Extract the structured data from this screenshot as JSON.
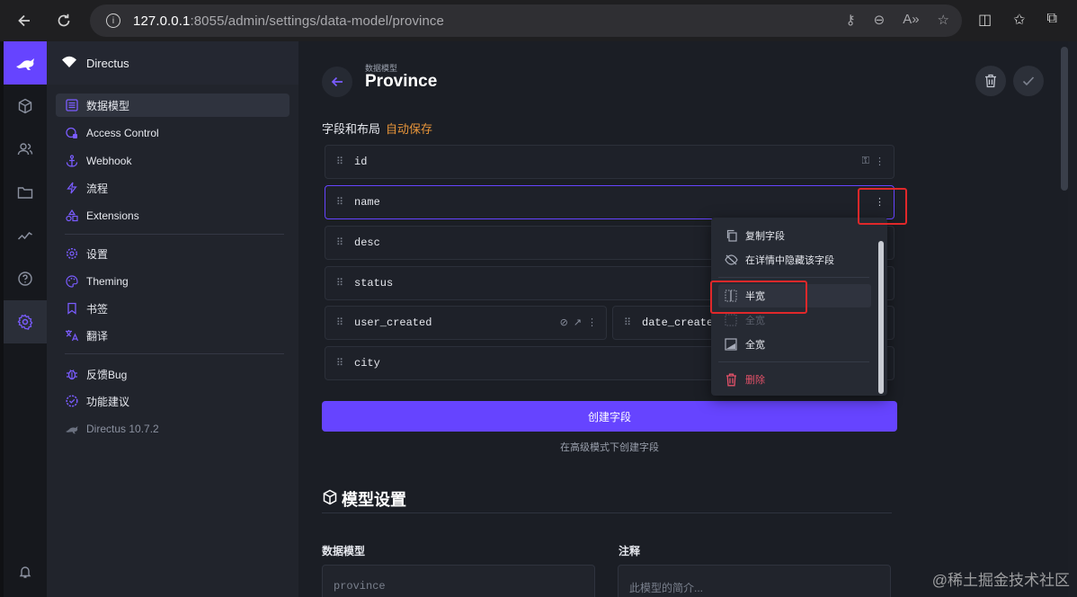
{
  "browser": {
    "url_host": "127.0.0.1",
    "url_rest": ":8055/admin/settings/data-model/province"
  },
  "project": {
    "name": "Directus"
  },
  "sidebar": {
    "items": [
      {
        "label": "数据模型",
        "icon": "data-model-icon"
      },
      {
        "label": "Access Control",
        "icon": "access-control-icon"
      },
      {
        "label": "Webhook",
        "icon": "anchor-icon"
      },
      {
        "label": "流程",
        "icon": "bolt-icon"
      },
      {
        "label": "Extensions",
        "icon": "extensions-icon"
      },
      {
        "label": "设置",
        "icon": "gear-icon"
      },
      {
        "label": "Theming",
        "icon": "palette-icon"
      },
      {
        "label": "书签",
        "icon": "bookmark-icon"
      },
      {
        "label": "翻译",
        "icon": "translate-icon"
      },
      {
        "label": "反馈Bug",
        "icon": "bug-icon"
      },
      {
        "label": "功能建议",
        "icon": "feature-icon"
      }
    ],
    "version": "Directus 10.7.2"
  },
  "header": {
    "breadcrumb": "数据模型",
    "title": "Province"
  },
  "fields_section": {
    "label": "字段和布局",
    "autosave": "自动保存"
  },
  "fields": {
    "id": "id",
    "name": "name",
    "desc": "desc",
    "status": "status",
    "user_created": "user_created",
    "date_created": "date_create",
    "city": "city"
  },
  "create_button": "创建字段",
  "advanced_link": "在高级模式下创建字段",
  "model_settings": {
    "title": "模型设置",
    "collection_label": "数据模型",
    "collection_value": "province",
    "note_label": "注释",
    "note_placeholder": "此模型的简介..."
  },
  "context_menu": {
    "duplicate": "复制字段",
    "hide_detail": "在详情中隐藏该字段",
    "half_width": "半宽",
    "full_width_dim": "全宽",
    "full_width": "全宽",
    "delete": "删除"
  },
  "watermark": "@稀土掘金技术社区",
  "colors": {
    "accent": "#6644ff",
    "autosave": "#e8953a",
    "danger": "#e35169",
    "annotation": "#e0282a"
  }
}
